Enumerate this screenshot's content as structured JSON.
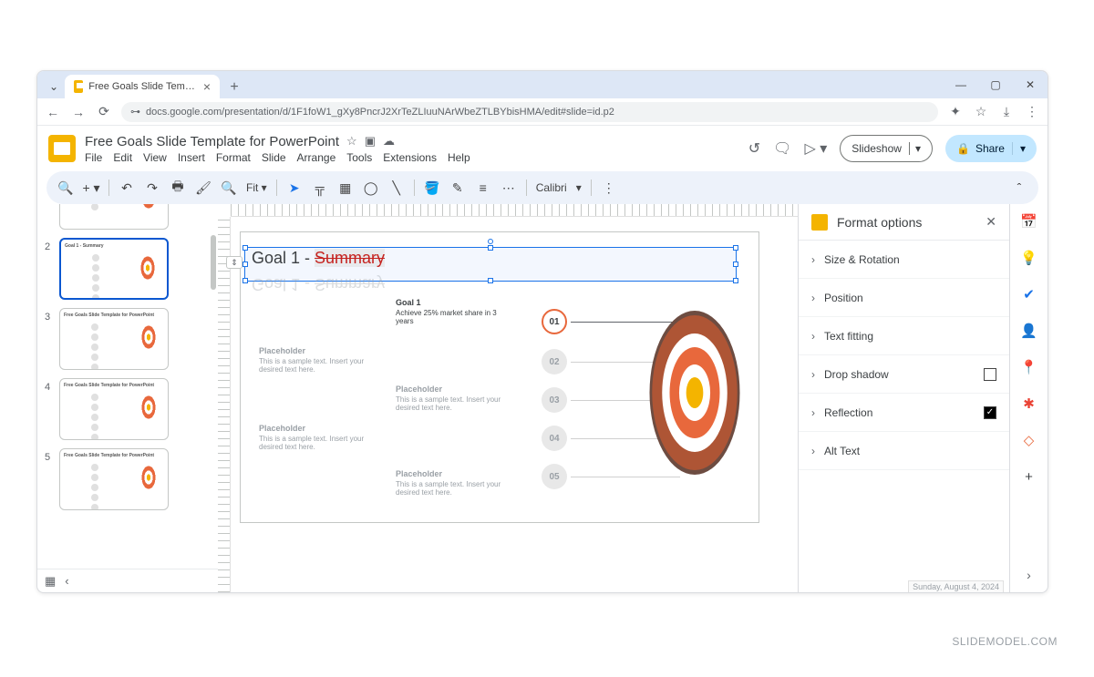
{
  "browser": {
    "tab_title": "Free Goals Slide Template for P...",
    "url": "docs.google.com/presentation/d/1F1foW1_gXy8PncrJ2XrTeZLIuuNArWbeZTLBYbisHMA/edit#slide=id.p2"
  },
  "doc": {
    "title": "Free Goals Slide Template for PowerPoint"
  },
  "menu": [
    "File",
    "Edit",
    "View",
    "Insert",
    "Format",
    "Slide",
    "Arrange",
    "Tools",
    "Extensions",
    "Help"
  ],
  "header_buttons": {
    "slideshow": "Slideshow",
    "share": "Share"
  },
  "toolbar": {
    "zoom": "Fit",
    "font": "Calibri"
  },
  "thumbs": [
    "",
    "2",
    "3",
    "4",
    "5"
  ],
  "slide": {
    "title_prefix": "Goal 1 - ",
    "title_strike": "Summary",
    "goal1_header": "Goal 1",
    "goal1_text": "Achieve 25% market share in 3 years",
    "placeholder_header": "Placeholder",
    "placeholder_text": "This is a sample text. Insert your desired text here.",
    "nums": [
      "01",
      "02",
      "03",
      "04",
      "05"
    ]
  },
  "format_panel": {
    "title": "Format options",
    "rows": [
      {
        "label": "Size & Rotation",
        "check": null
      },
      {
        "label": "Position",
        "check": null
      },
      {
        "label": "Text fitting",
        "check": null
      },
      {
        "label": "Drop shadow",
        "check": false
      },
      {
        "label": "Reflection",
        "check": true
      },
      {
        "label": "Alt Text",
        "check": null
      }
    ]
  },
  "status_date": "Sunday, August 4, 2024",
  "watermark": "SLIDEMODEL.COM"
}
